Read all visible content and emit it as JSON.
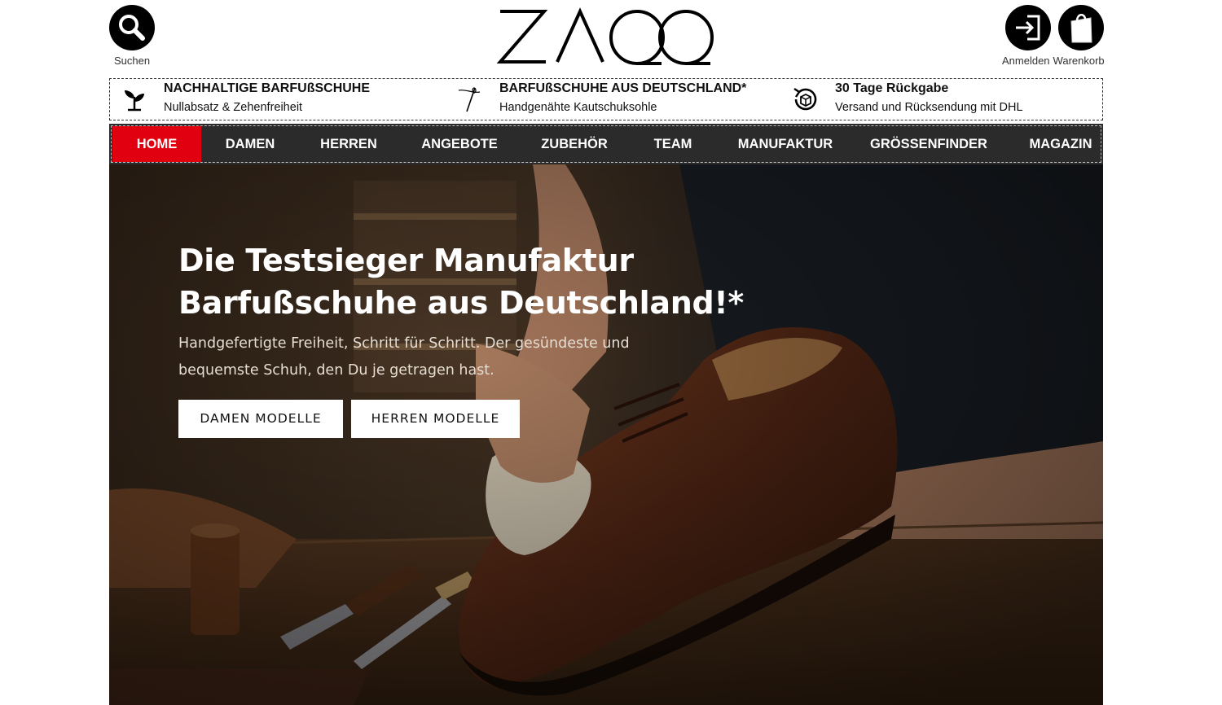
{
  "header": {
    "search_label": "Suchen",
    "login_label": "Anmelden",
    "cart_label": "Warenkorb",
    "logo_text": "ZAQQ"
  },
  "usp": [
    {
      "title": "NACHHALTIGE BARFUßSCHUHE",
      "subtitle": "Nullabsatz & Zehenfreiheit",
      "icon": "plant-icon"
    },
    {
      "title": "BARFUßSCHUHE AUS DEUTSCHLAND*",
      "subtitle": "Handgenähte Kautschuksohle",
      "icon": "needle-icon"
    },
    {
      "title": "30 Tage Rückgabe",
      "subtitle": "Versand und Rücksendung mit DHL",
      "icon": "return-box-icon"
    }
  ],
  "nav": {
    "items": [
      "HOME",
      "DAMEN",
      "HERREN",
      "ANGEBOTE",
      "ZUBEHÖR",
      "TEAM",
      "MANUFAKTUR",
      "GRÖSSENFINDER",
      "MAGAZIN"
    ],
    "active": "HOME",
    "active_color": "#e1000f"
  },
  "hero": {
    "title_line1": "Die Testsieger Manufaktur",
    "title_line2": "Barfußschuhe aus Deutschland!*",
    "subtitle_line1": "Handgefertigte Freiheit, Schritt für Schritt. Der gesündeste und",
    "subtitle_line2": "bequemste Schuh, den Du je getragen hast.",
    "button_women": "DAMEN MODELLE",
    "button_men": "HERREN MODELLE"
  }
}
